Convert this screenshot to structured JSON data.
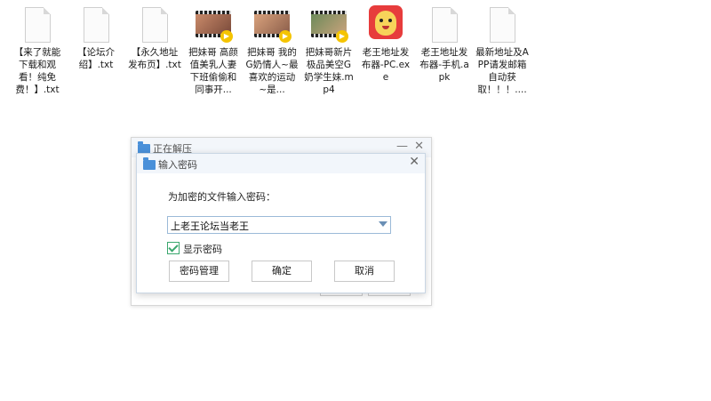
{
  "desktop": {
    "files": [
      {
        "icon": "text-file-icon",
        "label": "【来了就能下载和观看！纯免费！】.txt"
      },
      {
        "icon": "text-file-icon",
        "label": "【论坛介绍】.txt"
      },
      {
        "icon": "text-file-icon",
        "label": "【永久地址发布页】.txt"
      },
      {
        "icon": "video-file-icon",
        "label": "把妹哥 高颜值美乳人妻下班偷偷和同事开..."
      },
      {
        "icon": "video-file-icon",
        "label": "把妹哥 我的G奶情人~最喜欢的运动~是..."
      },
      {
        "icon": "video-file-icon",
        "label": "把妹哥新片极品美空G奶学生妹.mp4"
      },
      {
        "icon": "app-icon",
        "label": "老王地址发布器-PC.exe"
      },
      {
        "icon": "text-file-icon",
        "label": "老王地址发布器-手机.apk"
      },
      {
        "icon": "text-file-icon",
        "label": "最新地址及APP请发邮箱自动获取！！！...."
      }
    ]
  },
  "extract_dialog": {
    "title": "正在解压",
    "min_glyph": "—",
    "close_glyph": "✕"
  },
  "password_dialog": {
    "title": "输入密码",
    "close_glyph": "✕",
    "prompt": "为加密的文件输入密码：",
    "password_value": "上老王论坛当老王",
    "show_password_label": "显示密码",
    "show_password_checked": true,
    "buttons": {
      "manage": "密码管理",
      "ok": "确定",
      "cancel": "取消"
    }
  }
}
